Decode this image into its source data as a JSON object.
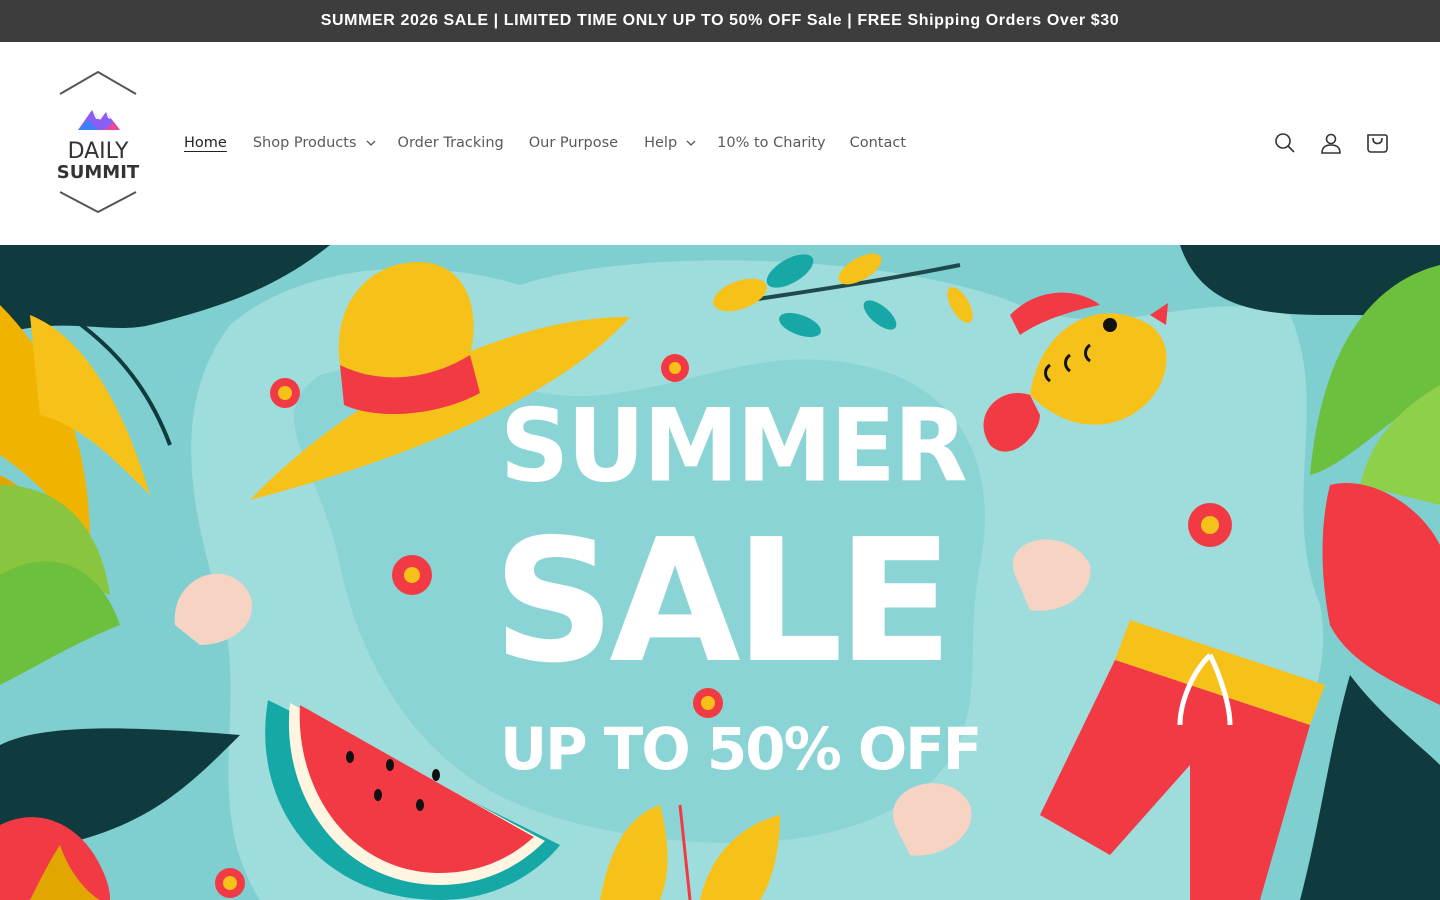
{
  "announcement": {
    "text": "SUMMER 2026 SALE | LIMITED TIME ONLY UP TO 50% OFF Sale | FREE Shipping Orders Over $30"
  },
  "brand": {
    "line1": "DAILY",
    "line2": "SUMMIT"
  },
  "nav": {
    "items": [
      {
        "label": "Home",
        "active": true
      },
      {
        "label": "Shop Products",
        "dropdown": true
      },
      {
        "label": "Order Tracking"
      },
      {
        "label": "Our Purpose"
      },
      {
        "label": "Help",
        "dropdown": true
      },
      {
        "label": "10% to Charity"
      },
      {
        "label": "Contact"
      }
    ]
  },
  "header_icons": [
    "search-icon",
    "account-icon",
    "cart-icon"
  ],
  "hero": {
    "line1": "SUMMER",
    "line2": "SALE",
    "line3": "UP TO 50% OFF",
    "colors": {
      "background": "#7fcfd1",
      "water": "#9fdcdc",
      "text": "#ffffff"
    }
  },
  "colors": {
    "announcement_bg": "#3d3d3d",
    "nav_text": "#5a5a5a"
  }
}
